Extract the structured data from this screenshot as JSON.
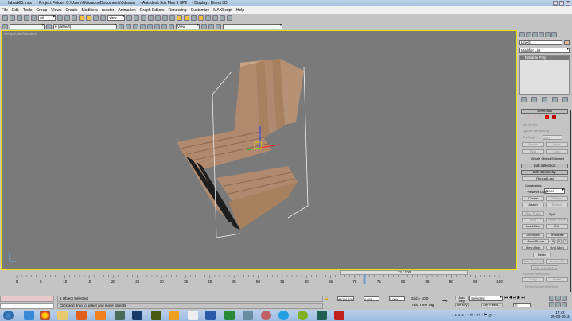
{
  "title": {
    "file": "fablab03.max",
    "project": "- Project Folder: C:\\Users\\Utilizador\\Documents\\3dsmax",
    "app": "- Autodesk 3ds Max 9 SP2",
    "display": "- Display : Direct 3D"
  },
  "menu": [
    "File",
    "Edit",
    "Tools",
    "Group",
    "Views",
    "Create",
    "Modifiers",
    "reactor",
    "Animation",
    "Graph Editors",
    "Rendering",
    "Customize",
    "MAXScript",
    "Help"
  ],
  "toolbar": {
    "selection_filter": "All",
    "ref_coord": "View",
    "layer": "0 (default)",
    "view2": "View"
  },
  "viewport": {
    "label": "Perspective/Disabled",
    "border_color": "#f0e000",
    "object_color": "#b08a6e"
  },
  "panel": {
    "object_name": "Line01",
    "object_color": "#e8b898",
    "modifier_list": "Modifier List",
    "stack_item": "Editable Poly",
    "selection": {
      "title": "Selection",
      "by_vertex": "By Vertex",
      "ignore_backfacing": "Ignore Backfacing",
      "by_angle": "By Angle:",
      "angle_value": "45,0",
      "shrink": "Shrink",
      "grow": "Grow",
      "ring": "Ring",
      "loop": "Loop",
      "status": "Whole Object Selected"
    },
    "soft_selection": "Soft Selection",
    "edit_geometry": {
      "title": "Edit Geometry",
      "repeat_last": "Repeat Last",
      "constraints_label": "Constraints:",
      "constraints_value": "None",
      "preserve_uvs": "Preserve UVs",
      "create": "Create",
      "collapse": "Collapse",
      "attach": "Attach",
      "detach": "Detach",
      "slice_plane": "Slice Plane",
      "split": "Split",
      "slice": "Slice",
      "reset_plane": "Reset Plane",
      "quickslice": "QuickSlice",
      "cut": "Cut",
      "msmooth": "MSmooth",
      "tessellate": "Tessellate",
      "make_planar": "Make Planar",
      "x": "X",
      "y": "Y",
      "z": "Z",
      "view_align": "View Align",
      "grid_align": "Grid Align",
      "relax": "Relax",
      "hide_selected": "Hide Selected",
      "unhide_all": "Unhide All",
      "hide_unselected": "Hide Unselected",
      "named_selections": "Named Selections:",
      "copy": "Copy",
      "paste": "Paste",
      "delete_isolated": "Delete Isolated Vertices"
    }
  },
  "timeline": {
    "frame": "72 / 100",
    "ticks": [
      "0",
      "5",
      "10",
      "15",
      "20",
      "25",
      "30",
      "35",
      "40",
      "45",
      "50",
      "55",
      "60",
      "65",
      "70",
      "75",
      "80",
      "85",
      "90",
      "95",
      "100"
    ],
    "current": 72
  },
  "status": {
    "selected": "1 Object Selected",
    "prompt": "Click and drag to select and move objects",
    "x": "94094,926",
    "y": "0,039",
    "z": "0,000",
    "grid": "Grid = 10,0",
    "add_time_tag": "Add Time Tag",
    "auto_key": "Auto Key",
    "set_key": "Set Key",
    "key_mode": "Selected",
    "key_filters": "Key Filters...",
    "frame_field": "72"
  },
  "taskbar": {
    "time": "17:42",
    "date": "25-03-2013"
  }
}
